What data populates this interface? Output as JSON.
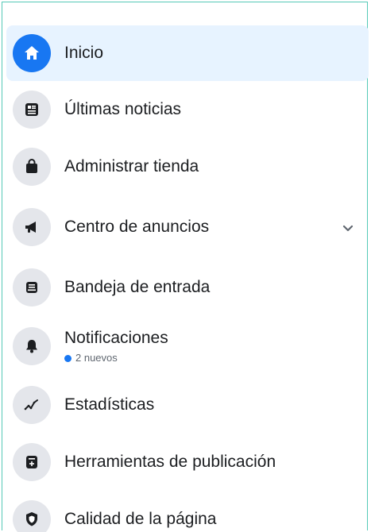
{
  "accent_color": "#1877f2",
  "nav": {
    "items": [
      {
        "label": "Inicio",
        "icon": "home-icon",
        "active": true
      },
      {
        "label": "Últimas noticias",
        "icon": "news-feed-icon"
      },
      {
        "label": "Administrar tienda",
        "icon": "shopping-bag-icon"
      },
      {
        "label": "Centro de anuncios",
        "icon": "megaphone-icon",
        "expandable": true,
        "expand_icon": "chevron-down-icon"
      },
      {
        "label": "Bandeja de entrada",
        "icon": "inbox-icon"
      },
      {
        "label": "Notificaciones",
        "icon": "bell-icon",
        "badge_text": "2 nuevos"
      },
      {
        "label": "Estadísticas",
        "icon": "insights-icon"
      },
      {
        "label": "Herramientas de publicación",
        "icon": "publishing-tools-icon"
      },
      {
        "label": "Calidad de la página",
        "icon": "shield-icon"
      }
    ]
  }
}
